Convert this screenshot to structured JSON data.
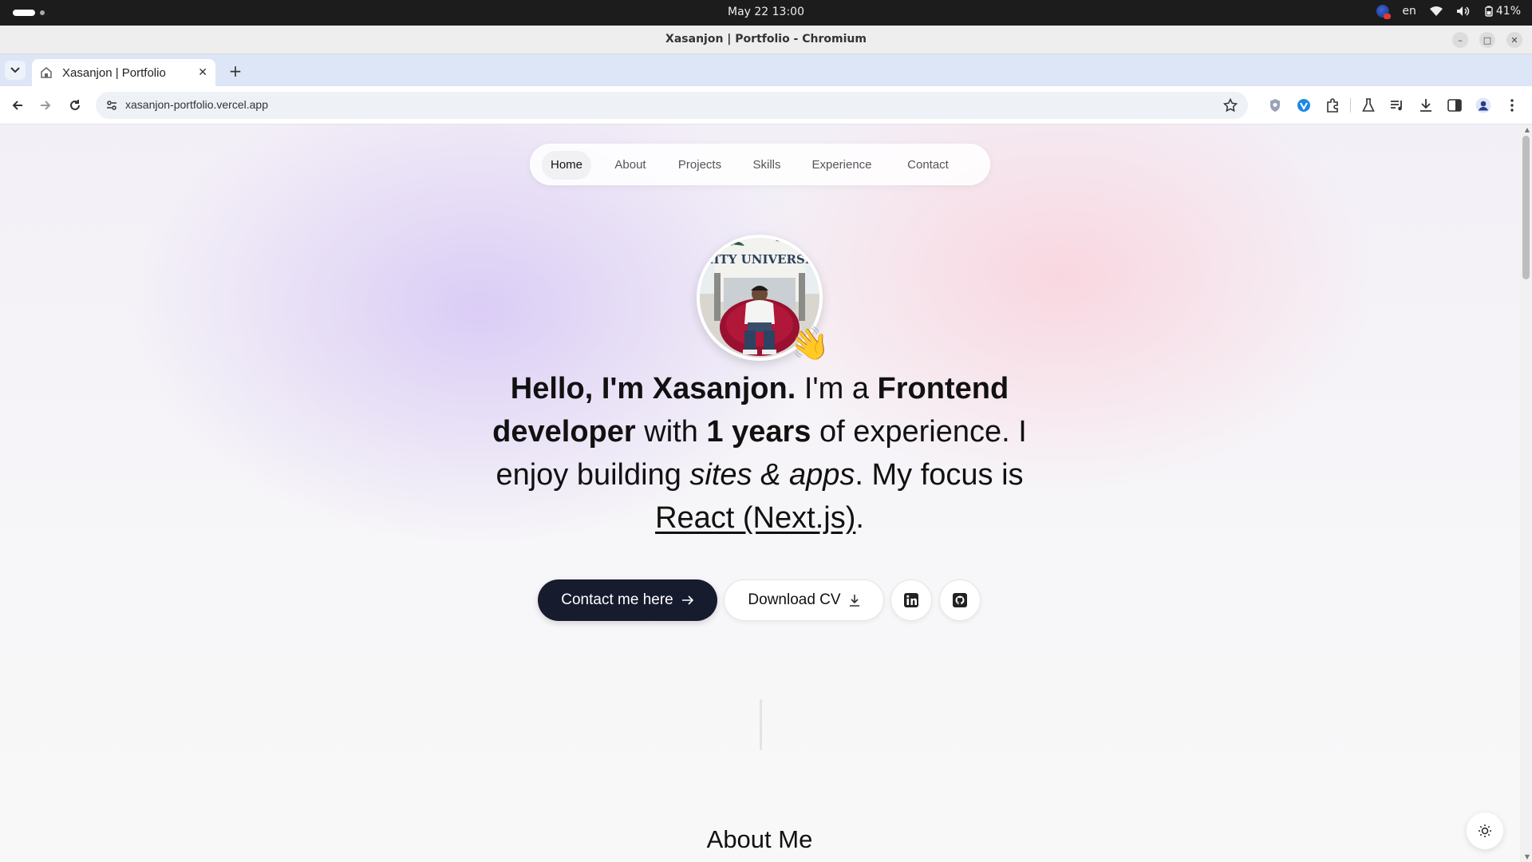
{
  "os": {
    "clock": "May 22  13:00",
    "language": "en",
    "battery": "41%"
  },
  "window": {
    "title": "Xasanjon | Portfolio - Chromium"
  },
  "tab": {
    "title": "Xasanjon | Portfolio"
  },
  "omnibox": {
    "url": "xasanjon-portfolio.vercel.app"
  },
  "site": {
    "nav": [
      "Home",
      "About",
      "Projects",
      "Skills",
      "Experience",
      "Contact"
    ],
    "active_nav": "Home",
    "intro": {
      "p1": "Hello, I'm Xasanjon.",
      "p2": " I'm a ",
      "p3": "Frontend developer",
      "p4": " with ",
      "p5": "1 years",
      "p6": " of experience. I enjoy building ",
      "p7": "sites & apps",
      "p8": ". My focus is ",
      "p9": "React (Next.js)",
      "p10": "."
    },
    "contact_button": "Contact me here",
    "cv_button": "Download CV",
    "about_heading": "About Me",
    "photo_sign": "AMITY UNIVERSITY"
  },
  "colors": {
    "primary_button": "#171b2e",
    "tab_strip": "#dde6f7",
    "lavender_glow": "#d6c6f5",
    "pink_glow": "#fad4de"
  }
}
